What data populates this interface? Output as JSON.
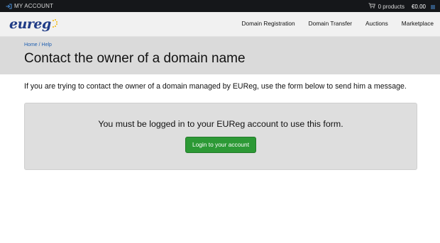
{
  "topbar": {
    "account_label": "MY ACCOUNT",
    "account_icon": "login-arrow-icon",
    "cart_icon": "cart-icon",
    "cart_count": "0 products",
    "cart_total": "€0.00",
    "menu_icon": "menu-icon"
  },
  "header": {
    "logo_text": "eureg",
    "brand_color": "#1f3b86",
    "accent_color": "#f2b705",
    "nav": [
      {
        "label": "Domain Registration"
      },
      {
        "label": "Domain Transfer"
      },
      {
        "label": "Auctions"
      },
      {
        "label": "Marketplace"
      }
    ]
  },
  "breadcrumb": {
    "items": [
      {
        "label": "Home"
      },
      {
        "label": "Help"
      }
    ],
    "separator": " / "
  },
  "page": {
    "title": "Contact the owner of a domain name",
    "intro": "If you are trying to contact the owner of a domain managed by EUReg, use the form below to send him a message."
  },
  "notice": {
    "message": "You must be logged in to your EUReg account to use this form.",
    "button_label": "Login to your account",
    "button_color": "#2c9935"
  }
}
